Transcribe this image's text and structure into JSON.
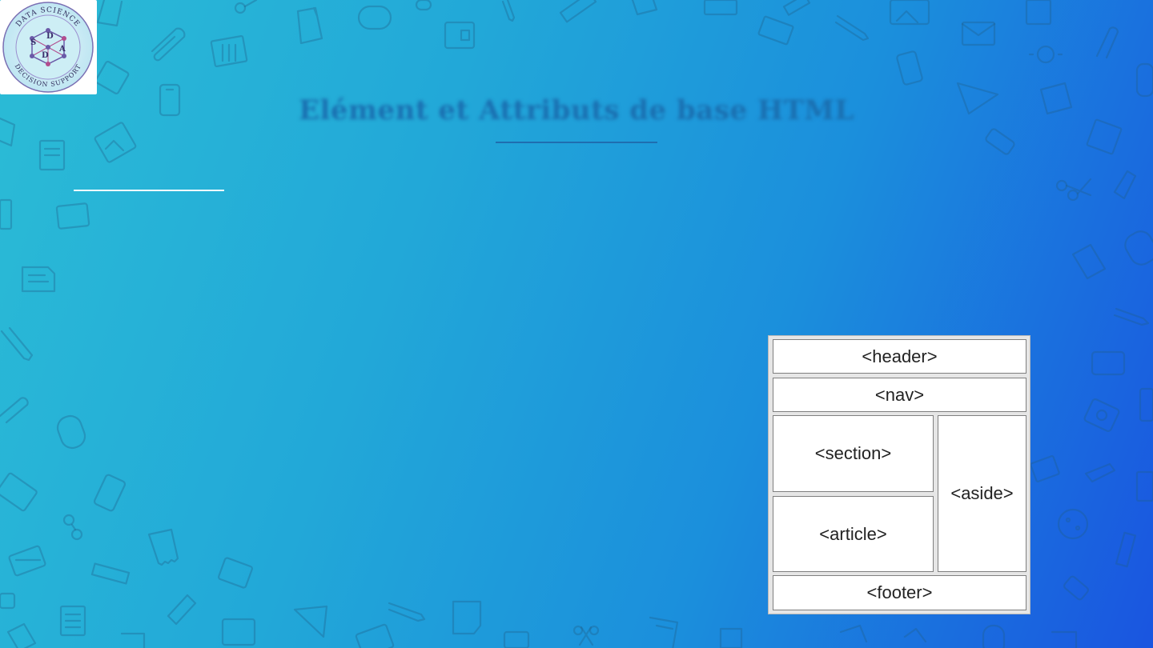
{
  "slide": {
    "title": "Elément et Attributs de base HTML"
  },
  "logo": {
    "ring_top_text": "DATA SCIENCE",
    "ring_bottom_text": "DECISION SUPPORT",
    "letters": [
      "S",
      "D",
      "D",
      "A"
    ]
  },
  "diagram": {
    "header": "<header>",
    "nav": "<nav>",
    "section": "<section>",
    "aside": "<aside>",
    "article": "<article>",
    "footer": "<footer>"
  },
  "colors": {
    "background_start": "#2bbcd6",
    "background_end": "#1a55e0",
    "title": "#1a6fb0"
  }
}
